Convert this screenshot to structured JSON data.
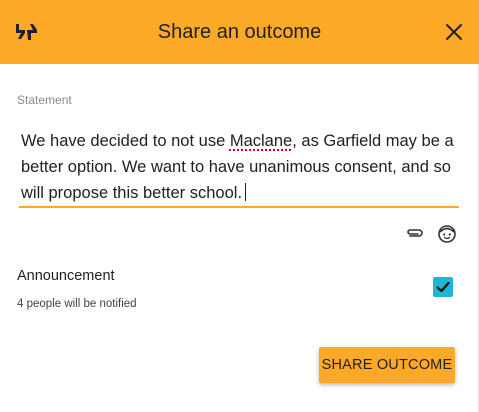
{
  "header": {
    "title": "Share an outcome",
    "logo_icon": "loomio-quote-logo-icon",
    "close_icon": "close-icon",
    "background": "#fba927"
  },
  "statement": {
    "label": "Statement",
    "text_before_spellerror": "We have decided to not use ",
    "misspelled_word": "Maclane",
    "text_after_spellerror": ", as Garfield may be a better option.  We want to have unanimous consent, and so will propose this better school."
  },
  "tools": {
    "attach_icon": "paperclip-icon",
    "emoji_icon": "emoji-face-icon"
  },
  "announcement": {
    "label": "Announcement",
    "subtext": "4 people will be notified",
    "checked": true,
    "checkbox_color": "#1fb6d4"
  },
  "actions": {
    "submit_label": "SHARE OUTCOME"
  }
}
